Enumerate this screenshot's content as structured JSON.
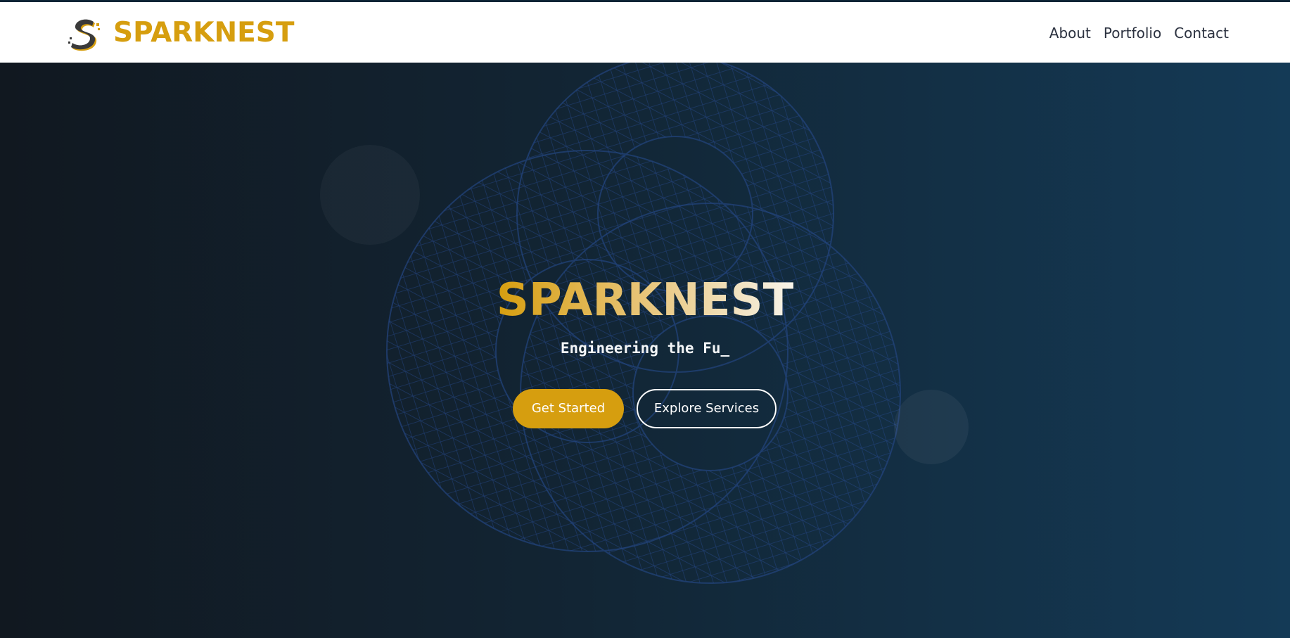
{
  "brand": {
    "name": "SPARKNEST",
    "logo_icon": "spark-s-logo-icon",
    "accent_color": "#d69e0f"
  },
  "nav": {
    "items": [
      {
        "label": "About"
      },
      {
        "label": "Portfolio"
      },
      {
        "label": "Contact"
      }
    ]
  },
  "hero": {
    "title": "SPARKNEST",
    "tagline": "Engineering the Fu_",
    "primary_button": "Get Started",
    "secondary_button": "Explore Services",
    "background_colors": [
      "#111820",
      "#143a56"
    ],
    "mesh_color": "#1f3d7a"
  }
}
